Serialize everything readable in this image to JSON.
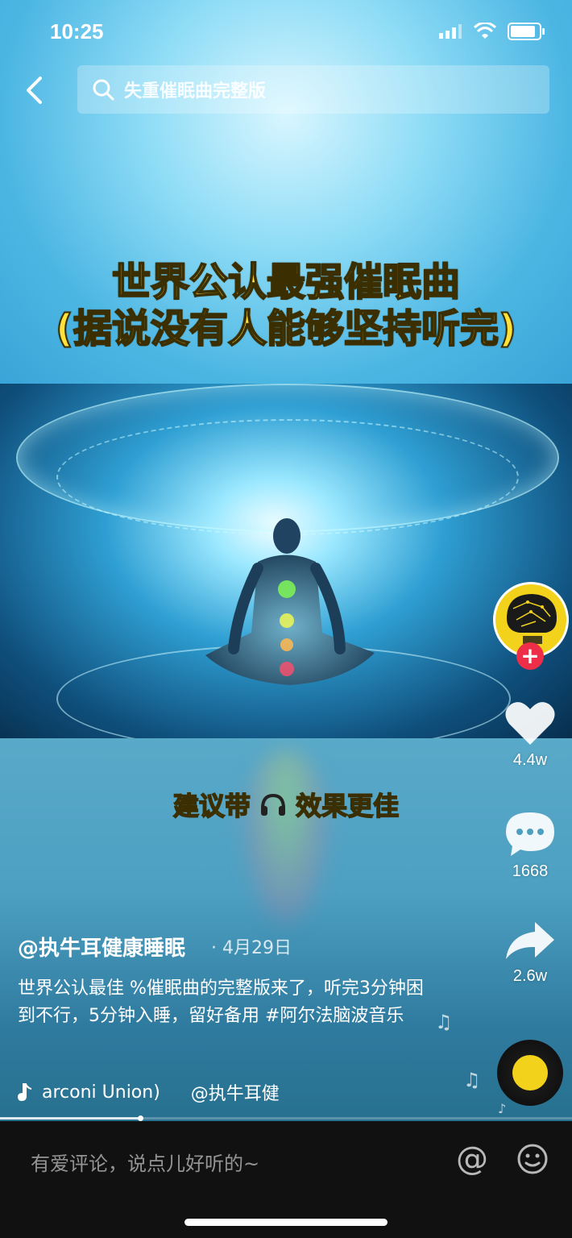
{
  "status_bar": {
    "time": "10:25"
  },
  "search": {
    "query": "失重催眠曲完整版"
  },
  "video": {
    "headline_line1": "世界公认最强催眠曲",
    "headline_line2": "(据说没有人能够坚持听完)",
    "subtitle_before": "建议带",
    "subtitle_after": "效果更佳",
    "progress_fraction": 0.245
  },
  "rail": {
    "likes": "4.4w",
    "comments": "1668",
    "shares": "2.6w",
    "follow_symbol": "+"
  },
  "post": {
    "author": "@执牛耳健康睡眠",
    "date": "· 4月29日",
    "description": "世界公认最佳 %催眠曲的完整版来了，听完3分钟困到不行，5分钟入睡，留好备用 #阿尔法脑波音乐",
    "music_title": "arconi Union)",
    "music_credit": "@执牛耳健"
  },
  "comment_bar": {
    "placeholder": "有爱评论，说点儿好听的~",
    "at_symbol": "@"
  },
  "colors": {
    "caption_yellow": "#ffe13b",
    "follow_red": "#ee2d49",
    "avatar_yellow": "#f2d21b"
  }
}
